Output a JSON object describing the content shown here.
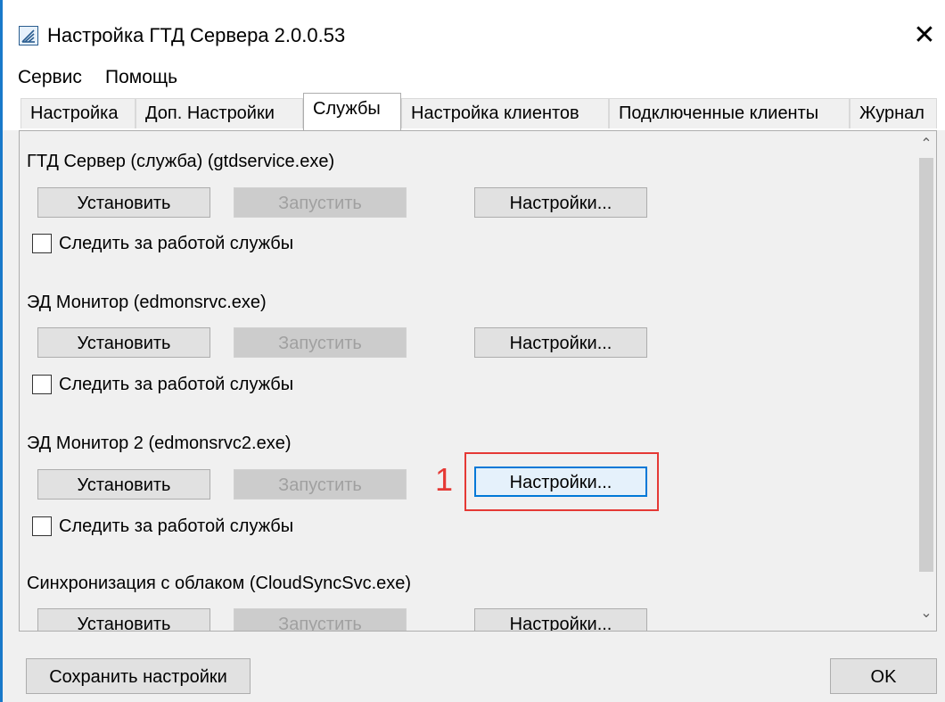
{
  "window": {
    "title": "Настройка ГТД Сервера 2.0.0.53",
    "close_glyph": "✕"
  },
  "menu": {
    "items": [
      {
        "label": "Сервис"
      },
      {
        "label": "Помощь"
      }
    ]
  },
  "tabs": [
    {
      "label": "Настройка",
      "active": false
    },
    {
      "label": "Доп. Настройки",
      "active": false
    },
    {
      "label": "Службы",
      "active": true
    },
    {
      "label": "Настройка клиентов",
      "active": false
    },
    {
      "label": "Подключенные клиенты",
      "active": false
    },
    {
      "label": "Журнал",
      "active": false
    }
  ],
  "services": [
    {
      "title": "ГТД Сервер (служба) (gtdservice.exe)",
      "install_label": "Установить",
      "start_label": "Запустить",
      "settings_label": "Настройки...",
      "monitor_label": "Следить за работой службы",
      "monitor_checked": false
    },
    {
      "title": "ЭД Монитор (edmonsrvc.exe)",
      "install_label": "Установить",
      "start_label": "Запустить",
      "settings_label": "Настройки...",
      "monitor_label": "Следить за работой службы",
      "monitor_checked": false
    },
    {
      "title": "ЭД Монитор 2 (edmonsrvc2.exe)",
      "install_label": "Установить",
      "start_label": "Запустить",
      "settings_label": "Настройки...",
      "monitor_label": "Следить за работой службы",
      "monitor_checked": false
    },
    {
      "title": "Синхронизация с облаком (CloudSyncSvc.exe)",
      "install_label": "Установить",
      "start_label": "Запустить",
      "settings_label": "Настройки..."
    }
  ],
  "annotation": {
    "number": "1",
    "color": "#e53935"
  },
  "scrollbar": {
    "up": "⌃",
    "down": "⌄"
  },
  "footer": {
    "save_label": "Сохранить настройки",
    "ok_label": "OK"
  },
  "colors": {
    "accent": "#1979ca",
    "focus": "#0078d7"
  }
}
